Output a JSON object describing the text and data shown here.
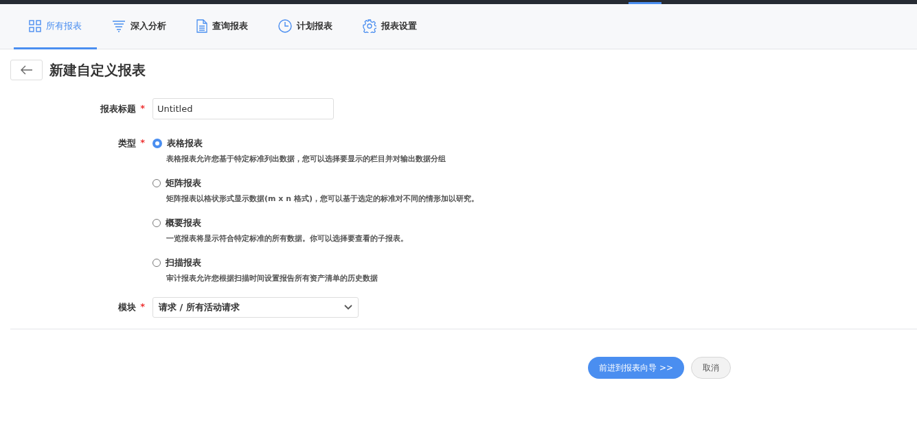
{
  "tabs": [
    {
      "label": "所有报表",
      "selected": true
    },
    {
      "label": "深入分析",
      "selected": false
    },
    {
      "label": "查询报表",
      "selected": false
    },
    {
      "label": "计划报表",
      "selected": false
    },
    {
      "label": "报表设置",
      "selected": false
    }
  ],
  "page_title": "新建自定义报表",
  "title_field": {
    "label": "报表标题",
    "required_mark": "*",
    "value": "Untitled"
  },
  "type_field": {
    "label": "类型",
    "required_mark": "*",
    "options": [
      {
        "label": "表格报表",
        "description": "表格报表允许您基于特定标准列出数据，您可以选择要显示的栏目并对输出数据分组",
        "selected": true
      },
      {
        "label": "矩阵报表",
        "description": "矩阵报表以格状形式显示数据(m x n 格式)，您可以基于选定的标准对不同的情形加以研究。",
        "selected": false
      },
      {
        "label": "概要报表",
        "description": "一览报表将显示符合特定标准的所有数据。你可以选择要查看的子报表。",
        "selected": false
      },
      {
        "label": "扫描报表",
        "description": "审计报表允许您根据扫描时间设置报告所有资产清单的历史数据",
        "selected": false
      }
    ]
  },
  "module_field": {
    "label": "模块",
    "required_mark": "*",
    "value": "请求 / 所有活动请求"
  },
  "buttons": [
    {
      "label": "前进到报表向导 >>",
      "kind": "primary"
    },
    {
      "label": "取消",
      "kind": "secondary"
    }
  ]
}
